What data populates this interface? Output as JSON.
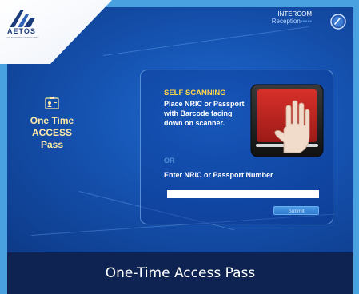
{
  "logo": {
    "name": "AETOS",
    "tagline": "YOUR SENSE OF SECURITY"
  },
  "intercom": {
    "label": "INTERCOM",
    "sub": "Reception",
    "dots": "▪▪▪▪▪"
  },
  "left": {
    "line1": "One Time",
    "line2": "ACCESS",
    "line3": "Pass"
  },
  "scan": {
    "title": "SELF SCANNING",
    "instructions": "Place NRIC or Passport with Barcode facing down on scanner.",
    "or": "OR",
    "enter_label": "Enter NRIC or Passport Number",
    "input_value": "",
    "submit": "Submit"
  },
  "caption": "One-Time Access Pass",
  "colors": {
    "accent_yellow": "#ffd84a",
    "left_text": "#ffe9a8",
    "frame": "#49a1e0",
    "caption_bg": "#0f2352"
  }
}
